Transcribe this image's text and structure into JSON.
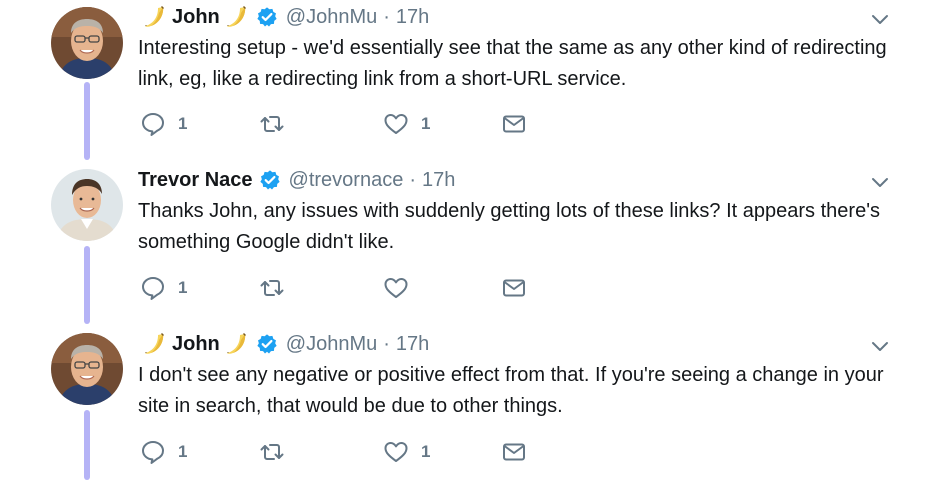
{
  "tweets": [
    {
      "author": "John",
      "emoji_prefix": "banana",
      "emoji_suffix": "banana",
      "verified": true,
      "handle": "@JohnMu",
      "separator": "·",
      "time": "17h",
      "text": "Interesting setup - we'd essentially see that the same as any other kind of redirecting link, eg, like a redirecting link from a short-URL service.",
      "reply_count": "1",
      "retweet_count": "",
      "like_count": "1"
    },
    {
      "author": "Trevor Nace",
      "verified": true,
      "handle": "@trevornace",
      "separator": "·",
      "time": "17h",
      "text": "Thanks John, any issues with suddenly getting lots of these links? It appears there's something Google didn't like.",
      "reply_count": "1",
      "retweet_count": "",
      "like_count": ""
    },
    {
      "author": "John",
      "emoji_prefix": "banana",
      "emoji_suffix": "banana",
      "verified": true,
      "handle": "@JohnMu",
      "separator": "·",
      "time": "17h",
      "text": "I don't see any negative or positive effect from that. If you're seeing a change in your site in search, that would be due to other things.",
      "reply_count": "1",
      "retweet_count": "",
      "like_count": "1"
    }
  ],
  "icons": {
    "reply": "reply-icon",
    "retweet": "retweet-icon",
    "like": "heart-icon",
    "dm": "envelope-icon",
    "more": "chevron-down-icon",
    "verified": "verified-badge-icon"
  },
  "colors": {
    "thread_line": "#b5b3f6",
    "verified": "#1da1f2",
    "icon_gray": "#657786",
    "text": "#14171a"
  }
}
